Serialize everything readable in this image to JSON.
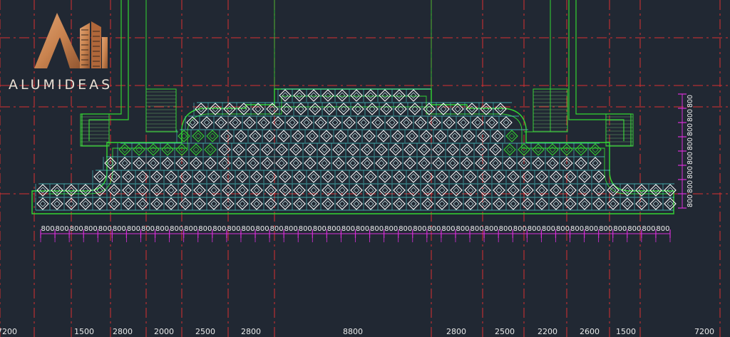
{
  "brand": {
    "name": "ALUMIDEAS"
  },
  "colors": {
    "background": "#212833",
    "axis_red": "#d93030",
    "outline_green": "#33d633",
    "grid_cyan": "#4fd2d2",
    "tile_white": "#ffffff",
    "dim_magenta": "#d92fd9",
    "logo_gold": "#c9834f"
  },
  "module_label": "800",
  "bottom_dimensions": [
    "7200",
    "1500",
    "2800",
    "2000",
    "2500",
    "2800",
    "8800",
    "2800",
    "2500",
    "2200",
    "2600",
    "1500",
    "7200"
  ],
  "side_dimension_count": 8,
  "bottom_module_count": 44
}
